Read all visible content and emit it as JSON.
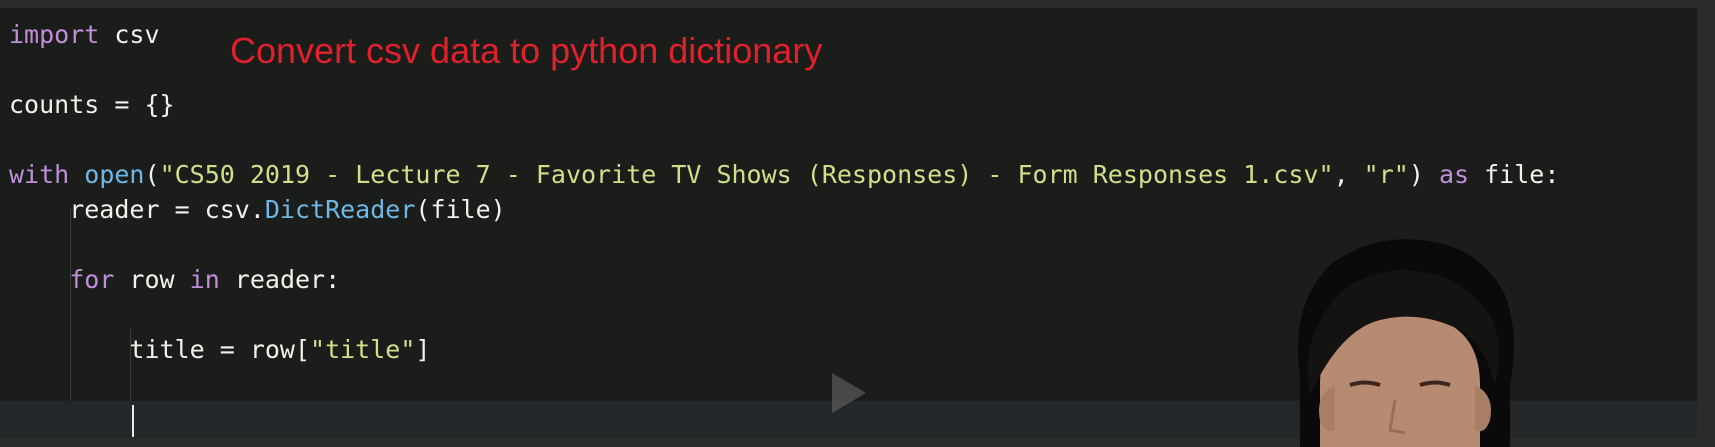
{
  "annotation": "Convert csv data to python dictionary",
  "code": {
    "line1": {
      "kw": "import",
      "rest": " csv"
    },
    "line2": {
      "text": "counts = {}"
    },
    "line3": {
      "kw": "with",
      "fn": "open",
      "paren_open": "(",
      "str1": "\"CS50 2019 - Lecture 7 - Favorite TV Shows (Responses) - Form Responses 1.csv\"",
      "comma": ", ",
      "str2": "\"r\"",
      "paren_close": ")",
      "kw2": "as",
      "rest": " file:"
    },
    "line4": {
      "pre": "    reader = csv.",
      "fn": "DictReader",
      "post": "(file)"
    },
    "line5": {
      "kw": "for",
      "mid": " row ",
      "kw2": "in",
      "rest": " reader:"
    },
    "line6": {
      "pre": "        title = row[",
      "str": "\"title\"",
      "post": "]"
    }
  },
  "icons": {
    "play": "play-icon"
  },
  "colors": {
    "keyword": "#c18ed9",
    "function": "#6fb7e6",
    "string": "#cfe08a",
    "annotation": "#e0202a",
    "background": "#1b1d1a"
  }
}
